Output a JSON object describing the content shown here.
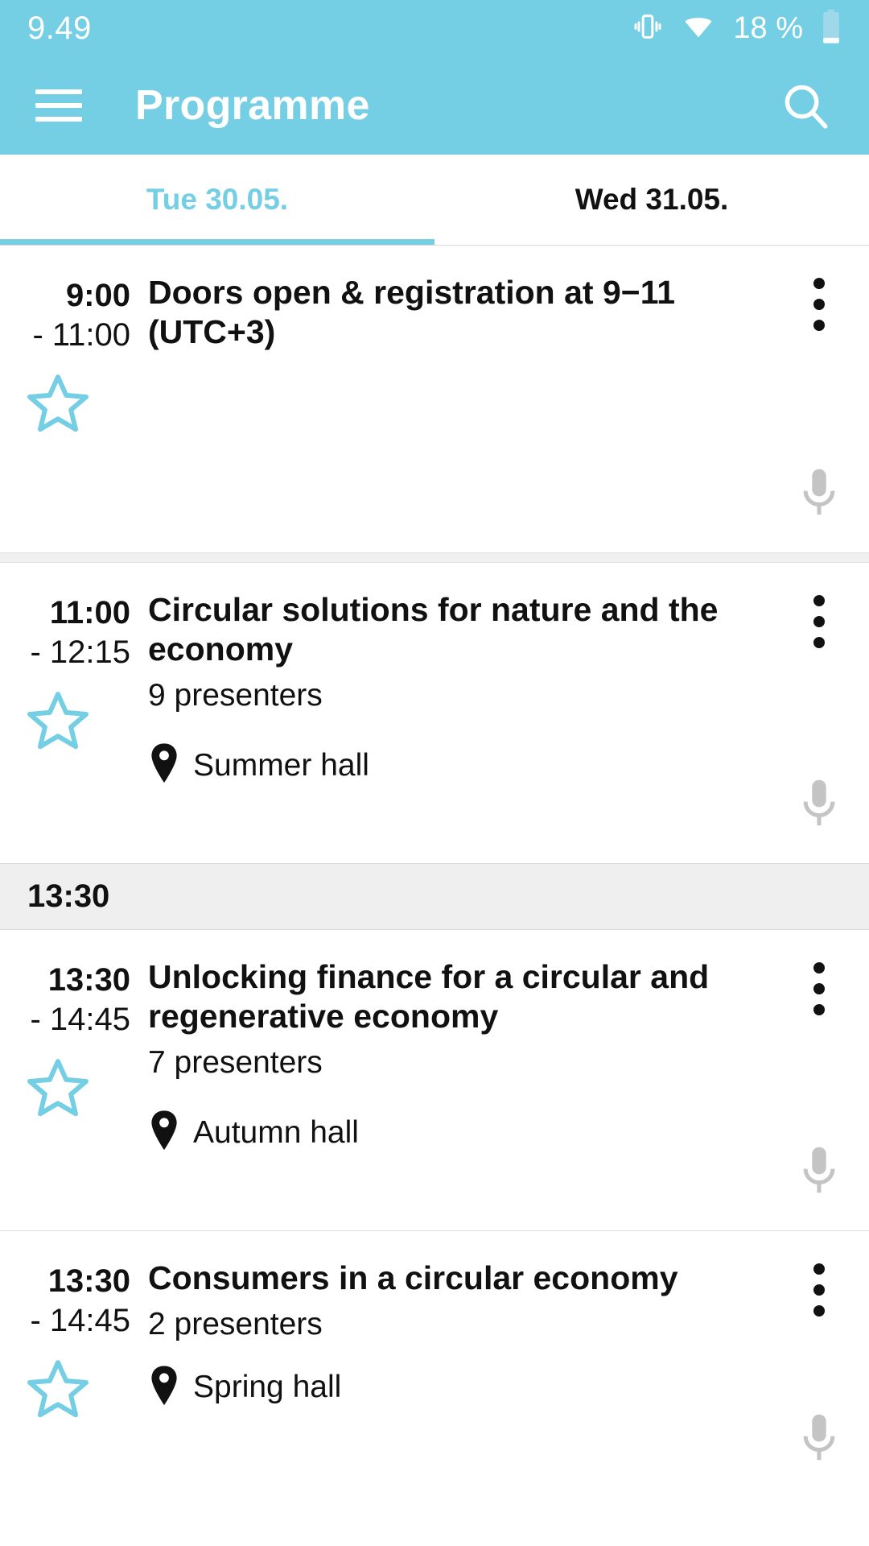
{
  "theme": {
    "accent": "#74cee4",
    "text": "#111111",
    "muted": "#c4c4c4",
    "section_bg": "#efefef"
  },
  "status_bar": {
    "clock": "9.49",
    "battery_percent": "18 %",
    "icons": [
      "vibrate-icon",
      "wifi-icon",
      "battery-icon"
    ]
  },
  "app_bar": {
    "title": "Programme",
    "menu_icon": "hamburger-menu-icon",
    "search_icon": "search-icon"
  },
  "tabs": [
    {
      "label": "Tue 30.05.",
      "active": true
    },
    {
      "label": "Wed 31.05.",
      "active": false
    }
  ],
  "list": [
    {
      "kind": "event",
      "time_start": "9:00",
      "time_end": "- 11:00",
      "title": "Doors open & registration at 9−11 (UTC+3)",
      "presenters": "",
      "location": "",
      "starred": false,
      "star_icon": "star-outline-icon",
      "mic_icon": "microphone-icon",
      "menu_icon": "overflow-menu-icon"
    },
    {
      "kind": "event",
      "time_start": "11:00",
      "time_end": "- 12:15",
      "title": "Circular solutions for nature and the economy",
      "presenters": "9 presenters",
      "location": "Summer hall",
      "starred": false,
      "star_icon": "star-outline-icon",
      "mic_icon": "microphone-icon",
      "menu_icon": "overflow-menu-icon",
      "location_icon": "location-pin-icon"
    },
    {
      "kind": "section",
      "label": "13:30"
    },
    {
      "kind": "event",
      "time_start": "13:30",
      "time_end": "- 14:45",
      "title": "Unlocking finance for a circular and regenerative economy",
      "presenters": "7 presenters",
      "location": "Autumn hall",
      "starred": false,
      "star_icon": "star-outline-icon",
      "mic_icon": "microphone-icon",
      "menu_icon": "overflow-menu-icon",
      "location_icon": "location-pin-icon"
    },
    {
      "kind": "event",
      "time_start": "13:30",
      "time_end": "- 14:45",
      "title": "Consumers in a circular economy",
      "presenters": "2 presenters",
      "location": "Spring hall",
      "starred": false,
      "star_icon": "star-outline-icon",
      "mic_icon": "microphone-icon",
      "menu_icon": "overflow-menu-icon",
      "location_icon": "location-pin-icon"
    }
  ]
}
